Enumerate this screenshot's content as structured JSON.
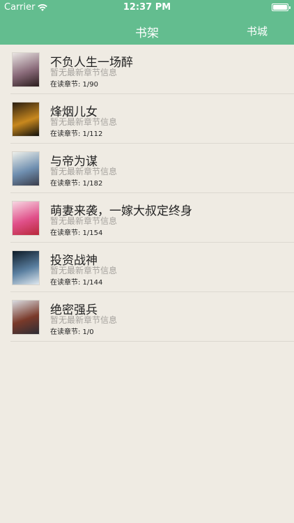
{
  "status_bar": {
    "carrier": "Carrier",
    "time": "12:37 PM"
  },
  "nav": {
    "title": "书架",
    "right_button": "书城"
  },
  "books": [
    {
      "title": "不负人生一场醉",
      "latest": "暂无最新章节信息",
      "progress": "在读章节: 1/90",
      "cover_colors": [
        "#e9e4e2",
        "#8a6b7a",
        "#2b1d1d"
      ]
    },
    {
      "title": "烽烟儿女",
      "latest": "暂无最新章节信息",
      "progress": "在读章节: 1/112",
      "cover_colors": [
        "#2a1e10",
        "#c8881e",
        "#10100c"
      ]
    },
    {
      "title": "与帝为谋",
      "latest": "暂无最新章节信息",
      "progress": "在读章节: 1/182",
      "cover_colors": [
        "#eef0ea",
        "#6f8fb0",
        "#3a3d4a"
      ]
    },
    {
      "title": "萌妻来袭，一嫁大叔定终身",
      "latest": "暂无最新章节信息",
      "progress": "在读章节: 1/154",
      "cover_colors": [
        "#f7d6e2",
        "#e0508a",
        "#b8283a"
      ]
    },
    {
      "title": "投资战神",
      "latest": "暂无最新章节信息",
      "progress": "在读章节: 1/144",
      "cover_colors": [
        "#0d1a26",
        "#5a7fa0",
        "#dfe8ef"
      ]
    },
    {
      "title": "绝密强兵",
      "latest": "暂无最新章节信息",
      "progress": "在读章节: 1/0",
      "cover_colors": [
        "#d9dbe0",
        "#7a3a2a",
        "#2d2d35"
      ]
    }
  ]
}
